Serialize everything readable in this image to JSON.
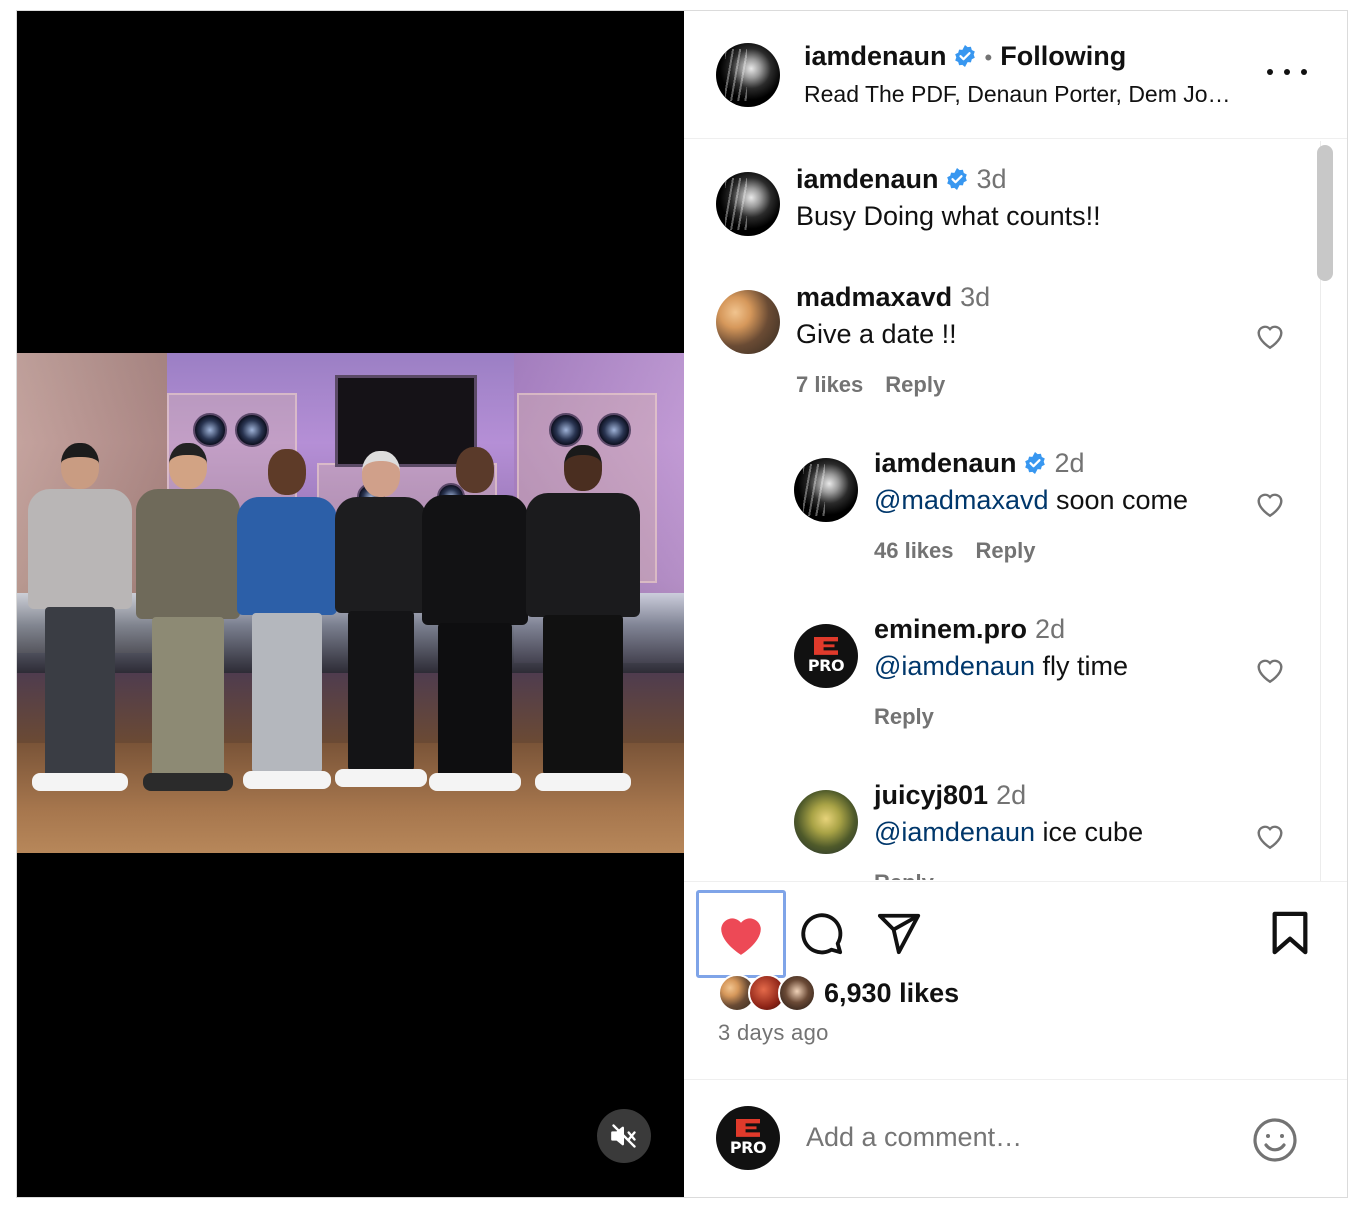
{
  "post": {
    "author": "iamdenaun",
    "follow_status": "Following",
    "separator": "•",
    "audio_subtitle": "Read The PDF, Denaun Porter, Dem Jo…",
    "likes": "6,930 likes",
    "posted": "3 days ago",
    "liked": true
  },
  "caption": {
    "username": "iamdenaun",
    "time": "3d",
    "text": "Busy Doing what counts!!"
  },
  "comments": [
    {
      "username": "madmaxavd",
      "time": "3d",
      "mention": "",
      "text": "Give a date !!",
      "likes": "7 likes",
      "reply": "Reply",
      "verified": false
    },
    {
      "username": "iamdenaun",
      "time": "2d",
      "mention": "@madmaxavd",
      "text": " soon come",
      "likes": "46 likes",
      "reply": "Reply",
      "verified": true
    },
    {
      "username": "eminem.pro",
      "time": "2d",
      "mention": "@iamdenaun",
      "text": " fly time",
      "likes": "",
      "reply": "Reply",
      "verified": false
    },
    {
      "username": "juicyj801",
      "time": "2d",
      "mention": "@iamdenaun",
      "text": " ice cube",
      "likes": "",
      "reply": "Reply",
      "verified": false
    }
  ],
  "avatar_badge_text": "PRO",
  "composer": {
    "placeholder": "Add a comment…"
  },
  "icons": {
    "like": "heart-filled-icon",
    "comment": "comment-icon",
    "share": "paper-plane-icon",
    "save": "bookmark-icon",
    "mute": "speaker-muted-icon",
    "more": "more-horizontal-icon",
    "emoji": "emoji-icon",
    "verified": "verified-badge-icon"
  },
  "colors": {
    "like_red": "#ed4956",
    "verified_blue": "#3897f0",
    "mention_blue": "#00376b",
    "muted_text": "#737373",
    "focus_ring": "#7fa4e8"
  }
}
